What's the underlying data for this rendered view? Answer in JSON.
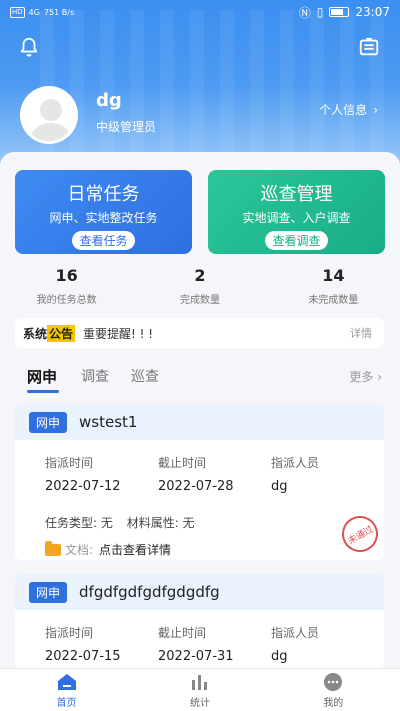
{
  "status_bar": {
    "left_items": [
      "HD",
      "4G",
      "751 B/s"
    ],
    "time": "23:07"
  },
  "header": {
    "icons": [
      "bell-icon",
      "menu-icon"
    ],
    "user_name": "dg",
    "user_role": "中级管理员",
    "profile_link": "个人信息",
    "background_color": "#3b8ff0"
  },
  "cards": {
    "daily": {
      "title": "日常任务",
      "subtitle": "网申、实地整改任务",
      "button": "查看任务",
      "color": "#2f6fe0"
    },
    "patrol": {
      "title": "巡查管理",
      "subtitle": "实地调查、入户调查",
      "button": "查看调查",
      "color": "#18ad86"
    }
  },
  "stats": [
    {
      "value": "16",
      "label": "我的任务总数"
    },
    {
      "value": "2",
      "label": "完成数量"
    },
    {
      "value": "14",
      "label": "未完成数量"
    }
  ],
  "notice": {
    "sys": "系统",
    "ann": "公告",
    "text": "重要提醒! ! !",
    "more": "详情"
  },
  "tabs": {
    "items": [
      "网申",
      "调查",
      "巡查"
    ],
    "active": "网申",
    "more": "更多"
  },
  "tasks": [
    {
      "tag": "网申",
      "name": "wstest1",
      "assign_label": "指派时间",
      "assign_date": "2022-07-12",
      "deadline_label": "截止时间",
      "deadline_date": "2022-07-28",
      "person_label": "指派人员",
      "person": "dg",
      "type_text": "任务类型: 无",
      "material_text": "材料属性: 无",
      "doc_label": "文档:",
      "doc_link": "点击查看详情",
      "stamp": "未通过"
    },
    {
      "tag": "网申",
      "name": "dfgdfgdfgdfgdgdfg",
      "assign_label": "指派时间",
      "assign_date": "2022-07-15",
      "deadline_label": "截止时间",
      "deadline_date": "2022-07-31",
      "person_label": "指派人员",
      "person": "dg"
    }
  ],
  "bottom_nav": [
    {
      "label": "首页",
      "icon": "home-icon",
      "active": true
    },
    {
      "label": "统计",
      "icon": "bar-chart-icon",
      "active": false
    },
    {
      "label": "我的",
      "icon": "user-chat-icon",
      "active": false
    }
  ]
}
